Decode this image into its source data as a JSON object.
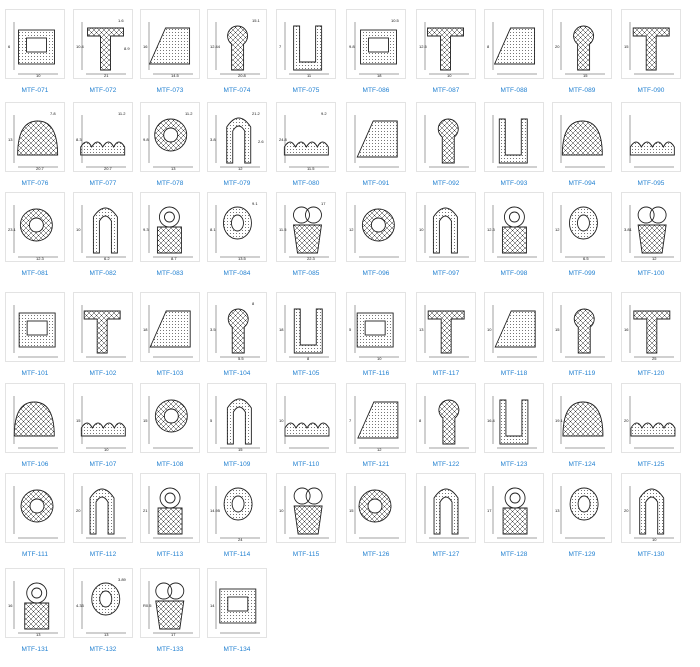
{
  "catalog": {
    "accent_color": "#1f7fd0",
    "rows": [
      [
        "MTF-071",
        "MTF-072",
        "MTF-073",
        "MTF-074",
        "MTF-075",
        "MTF-086",
        "MTF-087",
        "MTF-088",
        "MTF-089",
        "MTF-090"
      ],
      [
        "MTF-076",
        "MTF-077",
        "MTF-078",
        "MTF-079",
        "MTF-080",
        "MTF-091",
        "MTF-092",
        "MTF-093",
        "MTF-094",
        "MTF-095"
      ],
      [
        "MTF-081",
        "MTF-082",
        "MTF-083",
        "MTF-084",
        "MTF-085",
        "MTF-096",
        "MTF-097",
        "MTF-098",
        "MTF-099",
        "MTF-100"
      ],
      [
        "MTF-101",
        "MTF-102",
        "MTF-103",
        "MTF-104",
        "MTF-105",
        "MTF-116",
        "MTF-117",
        "MTF-118",
        "MTF-119",
        "MTF-120"
      ],
      [
        "MTF-106",
        "MTF-107",
        "MTF-108",
        "MTF-109",
        "MTF-110",
        "MTF-121",
        "MTF-122",
        "MTF-123",
        "MTF-124",
        "MTF-125"
      ],
      [
        "MTF-111",
        "MTF-112",
        "MTF-113",
        "MTF-114",
        "MTF-115",
        "MTF-126",
        "MTF-127",
        "MTF-128",
        "MTF-129",
        "MTF-130"
      ],
      [
        "MTF-131",
        "MTF-132",
        "MTF-133",
        "MTF-134"
      ]
    ],
    "drawings": [
      [
        "outline-dims",
        "dimension-callouts",
        "profile-figure",
        "profile-figure",
        "profile-figure"
      ],
      [
        "profile-figure",
        "profile-figure",
        "profile-figure",
        "profile-figure",
        "profile-figure"
      ]
    ],
    "dims": {
      "MTF-071": [
        "6",
        "10"
      ],
      "MTF-072": [
        "10.4",
        "21",
        "1.6",
        "8.9"
      ],
      "MTF-073": [
        "16",
        "14.5"
      ],
      "MTF-074": [
        "12.44",
        "20.8",
        "15.1"
      ],
      "MTF-075": [
        "7",
        "11"
      ],
      "MTF-086": [
        "9.8",
        "18",
        "10.5"
      ],
      "MTF-087": [
        "12.5",
        "10"
      ],
      "MTF-088": [
        "8"
      ],
      "MTF-089": [
        "20",
        "15"
      ],
      "MTF-090": [
        "15"
      ],
      "MTF-076": [
        "13",
        "20.7",
        "7.8"
      ],
      "MTF-077": [
        "8.3",
        "20.7",
        "11.2"
      ],
      "MTF-078": [
        "9.8",
        "13",
        "11.2"
      ],
      "MTF-079": [
        "3.8",
        "12",
        "21.2",
        "2.6"
      ],
      "MTF-080": [
        "24.8",
        "11.5",
        "9.2"
      ],
      "MTF-081": [
        "23.1",
        "12.3"
      ],
      "MTF-082": [
        "10",
        "6.2"
      ],
      "MTF-083": [
        "9.3",
        "8.7"
      ],
      "MTF-084": [
        "8.1",
        "13.5",
        "9.1"
      ],
      "MTF-085": [
        "11.5",
        "22.3",
        "17"
      ],
      "MTF-096": [
        "12"
      ],
      "MTF-097": [
        "10"
      ],
      "MTF-098": [
        "12.3"
      ],
      "MTF-099": [
        "12",
        "6.5"
      ],
      "MTF-100": [
        "3.81",
        "12"
      ],
      "MTF-103": [
        "18"
      ],
      "MTF-104": [
        "3.5",
        "5.5",
        "8"
      ],
      "MTF-105": [
        "18",
        "8"
      ],
      "MTF-116": [
        "5",
        "10"
      ],
      "MTF-117": [
        "13"
      ],
      "MTF-118": [
        "10"
      ],
      "MTF-119": [
        "15"
      ],
      "MTF-120": [
        "16",
        "25"
      ],
      "MTF-107": [
        "15",
        "10"
      ],
      "MTF-108": [
        "15"
      ],
      "MTF-109": [
        "5",
        "15"
      ],
      "MTF-110": [
        "10"
      ],
      "MTF-121": [
        "7",
        "12"
      ],
      "MTF-122": [
        "8"
      ],
      "MTF-123": [
        "16.4"
      ],
      "MTF-124": [
        "19.1"
      ],
      "MTF-125": [
        "20"
      ],
      "MTF-112": [
        "20"
      ],
      "MTF-113": [
        "21"
      ],
      "MTF-114": [
        "14.95",
        "24"
      ],
      "MTF-115": [
        "10"
      ],
      "MTF-126": [
        "15"
      ],
      "MTF-128": [
        "17"
      ],
      "MTF-129": [
        "13"
      ],
      "MTF-130": [
        "20",
        "10"
      ],
      "MTF-131": [
        "16",
        "13"
      ],
      "MTF-132": [
        "4.33",
        "13",
        "3.89"
      ],
      "MTF-133": [
        "R0.5",
        "17"
      ],
      "MTF-134": [
        "14"
      ]
    }
  }
}
